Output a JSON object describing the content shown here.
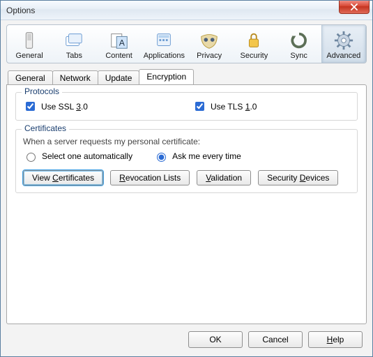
{
  "window": {
    "title": "Options"
  },
  "categories": [
    {
      "id": "general",
      "label": "General"
    },
    {
      "id": "tabs",
      "label": "Tabs"
    },
    {
      "id": "content",
      "label": "Content"
    },
    {
      "id": "applications",
      "label": "Applications"
    },
    {
      "id": "privacy",
      "label": "Privacy"
    },
    {
      "id": "security",
      "label": "Security"
    },
    {
      "id": "sync",
      "label": "Sync"
    },
    {
      "id": "advanced",
      "label": "Advanced"
    }
  ],
  "selected_category": "advanced",
  "subtabs": [
    {
      "id": "general",
      "label": "General"
    },
    {
      "id": "network",
      "label": "Network"
    },
    {
      "id": "update",
      "label": "Update"
    },
    {
      "id": "encryption",
      "label": "Encryption"
    }
  ],
  "selected_subtab": "encryption",
  "protocols": {
    "legend": "Protocols",
    "ssl": {
      "label_pre": "Use SSL ",
      "label_u": "3",
      "label_post": ".0",
      "checked": true
    },
    "tls": {
      "label_pre": "Use TLS ",
      "label_u": "1",
      "label_post": ".0",
      "checked": true
    }
  },
  "certificates": {
    "legend": "Certificates",
    "prompt_text": "When a server requests my personal certificate:",
    "auto": {
      "label": "Select one automatically",
      "checked": false
    },
    "ask": {
      "label": "Ask me every time",
      "checked": true
    },
    "buttons": {
      "view": {
        "pre": "View ",
        "u": "C",
        "post": "ertificates"
      },
      "revocation": {
        "pre": "",
        "u": "R",
        "post": "evocation Lists"
      },
      "validation": {
        "pre": "",
        "u": "V",
        "post": "alidation"
      },
      "devices": {
        "pre": "Security ",
        "u": "D",
        "post": "evices"
      }
    }
  },
  "footer": {
    "ok": "OK",
    "cancel": "Cancel",
    "help_u": "H",
    "help_post": "elp"
  }
}
